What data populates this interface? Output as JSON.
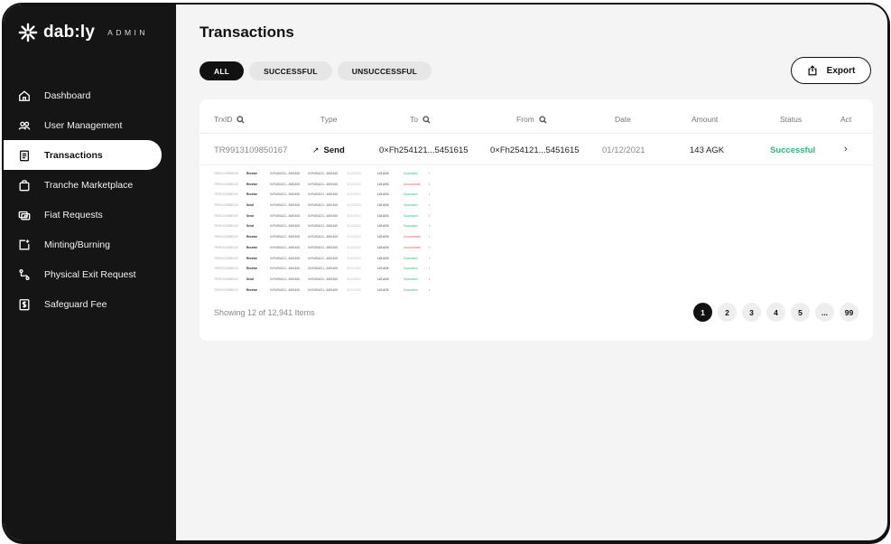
{
  "brand": {
    "name": "dab:ly",
    "subtitle": "ADMIN"
  },
  "sidebar": {
    "items": [
      {
        "label": "Dashboard",
        "icon": "home-icon",
        "active": false
      },
      {
        "label": "User Management",
        "icon": "users-icon",
        "active": false
      },
      {
        "label": "Transactions",
        "icon": "clipboard-icon",
        "active": true
      },
      {
        "label": "Tranche Marketplace",
        "icon": "bag-icon",
        "active": false
      },
      {
        "label": "Fiat Requests",
        "icon": "cards-icon",
        "active": false
      },
      {
        "label": "Minting/Burning",
        "icon": "mint-icon",
        "active": false
      },
      {
        "label": "Physical Exit Request",
        "icon": "route-icon",
        "active": false
      },
      {
        "label": "Safeguard Fee",
        "icon": "dollar-doc-icon",
        "active": false
      }
    ]
  },
  "page": {
    "title": "Transactions",
    "filters": [
      "ALL",
      "SUCCESSFUL",
      "UNSUCCESSFUL"
    ],
    "active_filter": "ALL",
    "export_label": "Export"
  },
  "table": {
    "headers": {
      "id": "TrxID",
      "type": "Type",
      "to": "To",
      "from": "From",
      "date": "Date",
      "amount": "Amount",
      "status": "Status",
      "action": "Act"
    },
    "first_row": {
      "id": "TR9913109850167",
      "type": "Send",
      "to": "0×Fh254121...5451615",
      "from": "0×Fh254121...5451615",
      "date": "01/12/2021",
      "amount": "143 AGK",
      "status": "Successful"
    },
    "mini_rows": [
      {
        "id": "TR9913109850167",
        "type": "Receive",
        "to": "0×Fh254121...5451615",
        "from": "0×Fh254121...5451615",
        "date": "01/12/2021",
        "amount": "143 AGK",
        "status": "Successful"
      },
      {
        "id": "TR9913109850167",
        "type": "Receive",
        "to": "0×Fh254121...5451615",
        "from": "0×Fh254121...5451615",
        "date": "01/12/2021",
        "amount": "143 AGK",
        "status": "Unsuccessful"
      },
      {
        "id": "TR9913109850167",
        "type": "Receive",
        "to": "0×Fh254121...5451615",
        "from": "0×Fh254121...5451615",
        "date": "01/12/2021",
        "amount": "143 AGK",
        "status": "Successful"
      },
      {
        "id": "TR9913109850167",
        "type": "Send",
        "to": "0×Fh254121...5451615",
        "from": "0×Fh254121...5451615",
        "date": "01/12/2021",
        "amount": "143 AGK",
        "status": "Successful"
      },
      {
        "id": "TR9913109850167",
        "type": "Send",
        "to": "0×Fh254121...5451615",
        "from": "0×Fh254121...5451615",
        "date": "01/12/2021",
        "amount": "143 AGK",
        "status": "Successful"
      },
      {
        "id": "TR9913109850167",
        "type": "Send",
        "to": "0×Fh254121...5451615",
        "from": "0×Fh254121...5451615",
        "date": "01/12/2021",
        "amount": "143 AGK",
        "status": "Successful"
      },
      {
        "id": "TR9913109850167",
        "type": "Receive",
        "to": "0×Fh254121...5451615",
        "from": "0×Fh254121...5451615",
        "date": "01/12/2021",
        "amount": "143 AGK",
        "status": "Unsuccessful"
      },
      {
        "id": "TR9913109850167",
        "type": "Receive",
        "to": "0×Fh254121...5451615",
        "from": "0×Fh254121...5451615",
        "date": "01/12/2021",
        "amount": "143 AGK",
        "status": "Unsuccessful"
      },
      {
        "id": "TR9913109850167",
        "type": "Receive",
        "to": "0×Fh254121...5451615",
        "from": "0×Fh254121...5451615",
        "date": "01/12/2021",
        "amount": "143 AGK",
        "status": "Successful"
      },
      {
        "id": "TR9913109850167",
        "type": "Receive",
        "to": "0×Fh254121...5451615",
        "from": "0×Fh254121...5451615",
        "date": "01/12/2021",
        "amount": "143 AGK",
        "status": "Successful"
      },
      {
        "id": "TR9913109850167",
        "type": "Send",
        "to": "0×Fh254121...5451615",
        "from": "0×Fh254121...5451615",
        "date": "01/12/2021",
        "amount": "143 AGK",
        "status": "Successful"
      },
      {
        "id": "TR9913109850167",
        "type": "Receive",
        "to": "0×Fh254121...5451615",
        "from": "0×Fh254121...5451615",
        "date": "01/12/2021",
        "amount": "143 AGK",
        "status": "Successful"
      }
    ],
    "showing": "Showing 12 of 12,941 Items"
  },
  "pagination": {
    "pages": [
      "1",
      "2",
      "3",
      "4",
      "5",
      "...",
      "99"
    ],
    "active": "1"
  },
  "colors": {
    "sidebar_bg": "#151515",
    "success": "#2fb87e",
    "failure": "#e35a5a",
    "accent": "#111111"
  }
}
